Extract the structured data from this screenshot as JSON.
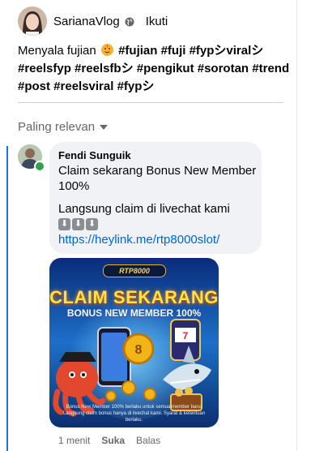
{
  "post": {
    "author": "SarianaVlog",
    "follow_label": "Ikuti",
    "text_before_emoji": "Menyala fujian",
    "text_after_emoji": " #fujian #fuji #fypシviralシ #reelsfyp #reelsfbシ #pengikut #sorotan #trend #post #reelsviral #fypシ"
  },
  "sort": {
    "label": "Paling relevan"
  },
  "comment": {
    "author": "Fendi Sunguik",
    "line1": "Claim sekarang Bonus New Member",
    "line2": "100%",
    "line3": "Langsung claim di livechat kami",
    "arrows": [
      "⬇",
      "⬇",
      "⬇"
    ],
    "link": "https://heylink.me/rtp8000slot/",
    "image": {
      "logo_text": "RTP8000",
      "title": "CLAIM SEKARANG",
      "subtitle": "BONUS NEW MEMBER 100%",
      "fine_print": "Bonus New Member 100% berlaku untuk semua member baru. Langsung claim bonus hanya di livechat kami. Syarat & ketentuan berlaku."
    },
    "time": "1 menit",
    "like_label": "Suka",
    "reply_label": "Balas"
  },
  "colors": {
    "link": "#0064d1",
    "online": "#31a24c",
    "bubble": "#f0f2f5",
    "accent": "#1b74e4"
  },
  "icons": {
    "globe": "globe-icon",
    "sort": "chevron-down-icon"
  }
}
